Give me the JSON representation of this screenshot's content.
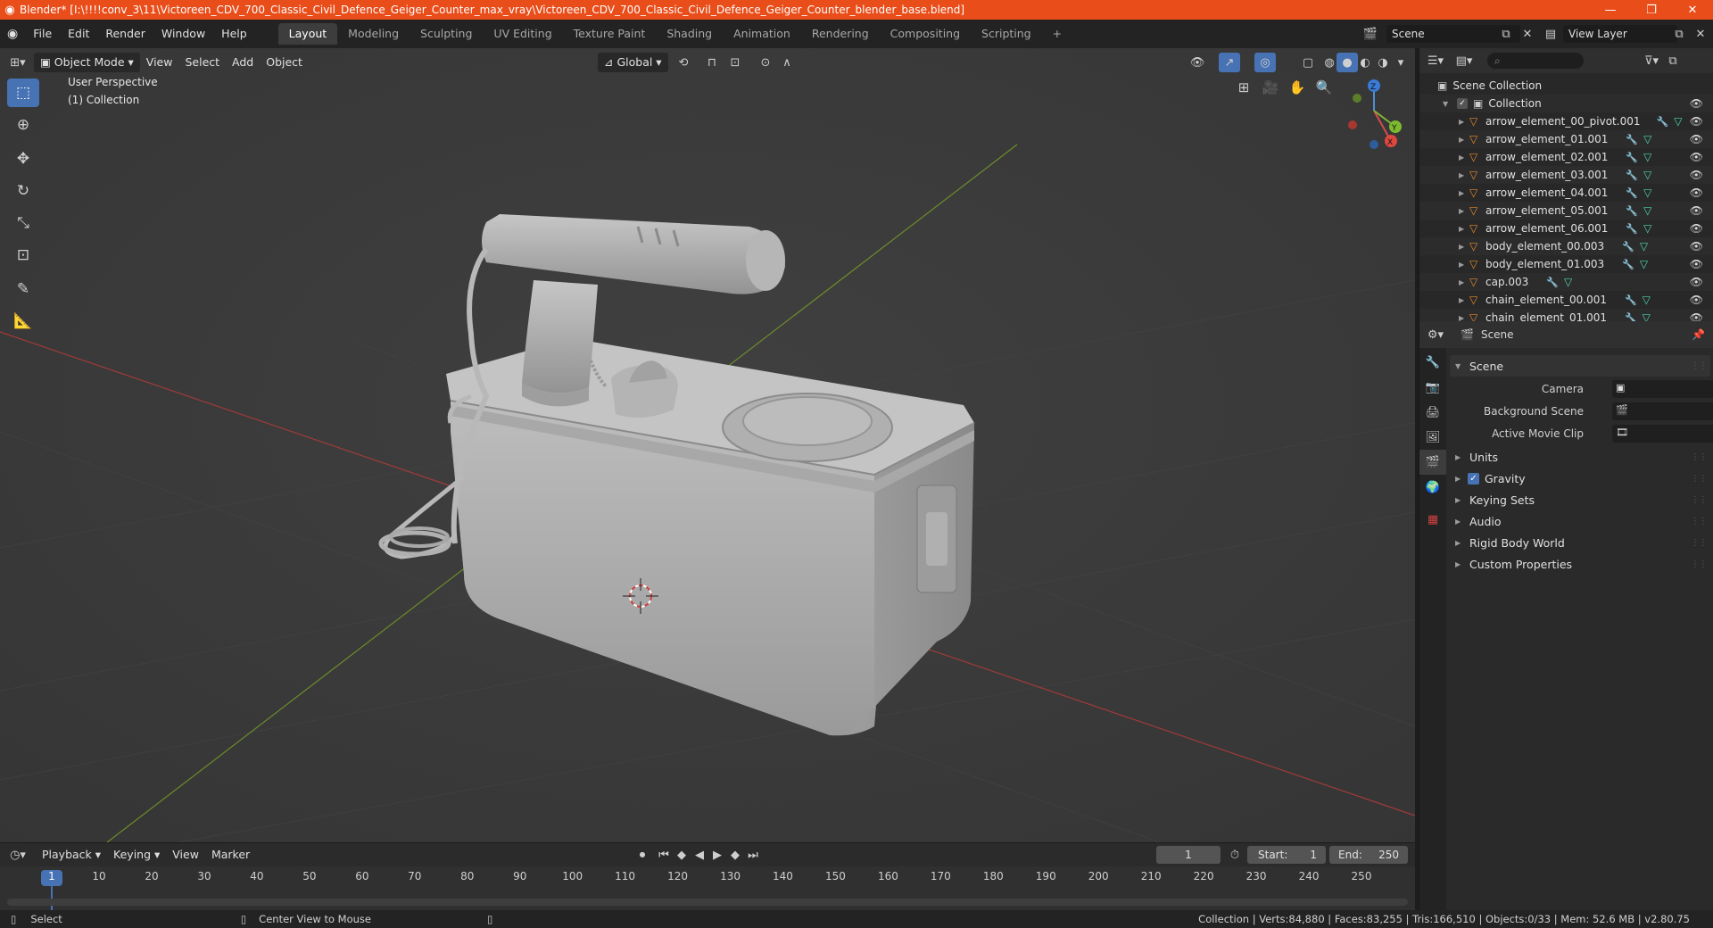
{
  "window": {
    "title": "Blender* [I:\\!!!!conv_3\\11\\Victoreen_CDV_700_Classic_Civil_Defence_Geiger_Counter_max_vray\\Victoreen_CDV_700_Classic_Civil_Defence_Geiger_Counter_blender_base.blend]",
    "accent_color": "#e94d1a"
  },
  "menubar": {
    "menus": [
      "File",
      "Edit",
      "Render",
      "Window",
      "Help"
    ],
    "workspaces": [
      "Layout",
      "Modeling",
      "Sculpting",
      "UV Editing",
      "Texture Paint",
      "Shading",
      "Animation",
      "Rendering",
      "Compositing",
      "Scripting"
    ],
    "active_workspace": "Layout",
    "add_workspace": "+",
    "scene_name": "Scene",
    "view_layer": "View Layer"
  },
  "viewport": {
    "mode": "Object Mode",
    "menus": [
      "View",
      "Select",
      "Add",
      "Object"
    ],
    "orientation": "Global",
    "view_name": "User Perspective",
    "collection_label": "(1) Collection",
    "gizmo_axes": {
      "x": "X",
      "y": "Y",
      "z": "Z"
    },
    "background": "#3b3b3b"
  },
  "outliner": {
    "root": "Scene Collection",
    "collection": "Collection",
    "items": [
      {
        "name": "arrow_element_00_pivot.001"
      },
      {
        "name": "arrow_element_01.001"
      },
      {
        "name": "arrow_element_02.001"
      },
      {
        "name": "arrow_element_03.001"
      },
      {
        "name": "arrow_element_04.001"
      },
      {
        "name": "arrow_element_05.001"
      },
      {
        "name": "arrow_element_06.001"
      },
      {
        "name": "body_element_00.003"
      },
      {
        "name": "body_element_01.003"
      },
      {
        "name": "cap.003"
      },
      {
        "name": "chain_element_00.001"
      },
      {
        "name": "chain_element_01.001"
      }
    ]
  },
  "properties": {
    "context": "Scene",
    "panel_title": "Scene",
    "fields": [
      {
        "label": "Camera"
      },
      {
        "label": "Background Scene"
      },
      {
        "label": "Active Movie Clip"
      }
    ],
    "subpanels": [
      "Units",
      "Gravity",
      "Keying Sets",
      "Audio",
      "Rigid Body World",
      "Custom Properties"
    ],
    "gravity_checked": true
  },
  "timeline": {
    "menus": [
      "Playback",
      "Keying",
      "View",
      "Marker"
    ],
    "current_frame": "1",
    "start_label": "Start:",
    "start": "1",
    "end_label": "End:",
    "end": "250",
    "ticks": [
      "1",
      "10",
      "20",
      "30",
      "40",
      "50",
      "60",
      "70",
      "80",
      "90",
      "100",
      "110",
      "120",
      "130",
      "140",
      "150",
      "160",
      "170",
      "180",
      "190",
      "200",
      "210",
      "220",
      "230",
      "240",
      "250"
    ]
  },
  "statusbar": {
    "left_action": "Select",
    "middle_action": "Center View to Mouse",
    "stats": "Collection | Verts:84,880 | Faces:83,255 | Tris:166,510 | Objects:0/33 | Mem: 52.6 MB | v2.80.75"
  }
}
